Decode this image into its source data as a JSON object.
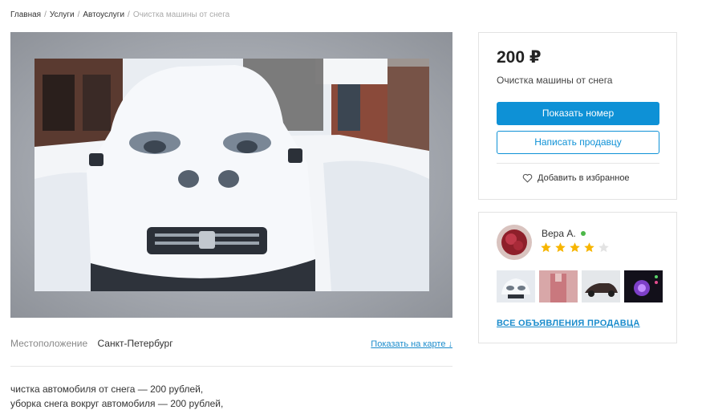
{
  "breadcrumb": {
    "items": [
      "Главная",
      "Услуги",
      "Автоуслуги"
    ],
    "current": "Очистка машины от снега",
    "separator": "/"
  },
  "listing": {
    "price": "200 ₽",
    "title": "Очистка машины от снега",
    "show_phone_label": "Показать номер",
    "message_seller_label": "Написать продавцу",
    "favorite_label": "Добавить в избранное"
  },
  "location": {
    "label": "Местоположение",
    "city": "Санкт-Петербург",
    "map_link": "Показать на карте ↓"
  },
  "description": {
    "lines": [
      "чистка автомобиля от снега — 200 рублей,",
      "уборка снега вокруг автомобиля — 200 рублей,"
    ]
  },
  "seller": {
    "name": "Вера А.",
    "online": true,
    "rating": 4,
    "max_rating": 5,
    "all_ads_label": "ВСЕ ОБЪЯВЛЕНИЯ ПРОДАВЦА"
  },
  "colors": {
    "accent": "#0e91d6",
    "link": "#1b8ccc",
    "star": "#f7b500",
    "star_empty": "#e3e3e3",
    "online": "#4cb849"
  }
}
